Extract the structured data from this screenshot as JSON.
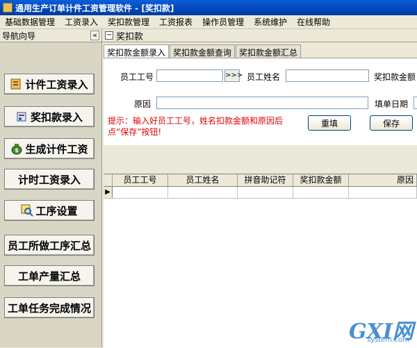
{
  "window": {
    "title": "通用生产订单计件工资管理软件 - [奖扣款]"
  },
  "menu": [
    "基础数据管理",
    "工资录入",
    "奖扣款管理",
    "工资报表",
    "操作员管理",
    "系统维护",
    "在线帮助"
  ],
  "nav": {
    "title": "导航向导",
    "collapse": "«",
    "items": [
      "计件工资录入",
      "奖扣款录入",
      "生成计件工资",
      "计时工资录入",
      "工序设置",
      "员工所做工序汇总",
      "工单产量汇总",
      "工单任务完成情况"
    ]
  },
  "panel": {
    "title": "奖扣款",
    "minus": "−",
    "tabs": [
      "奖扣款金额录入",
      "奖扣款金额查询",
      "奖扣款金额汇总"
    ]
  },
  "form": {
    "emp_id_label": "员工工号",
    "emp_id_value": "",
    "lookup": ">>>",
    "emp_name_label": "员工姓名",
    "emp_name_value": "",
    "amount_label": "奖扣款金额",
    "reason_label": "原因",
    "reason_value": "",
    "date_label": "填单日期",
    "hint": "提示：输入好员工工号，姓名扣款金额和原因后点“保存”按钮!",
    "reset_label": "重填",
    "save_label": "保存"
  },
  "grid": {
    "columns": [
      "员工工号",
      "员工姓名",
      "拼音助记符",
      "奖扣款金额",
      "原因"
    ],
    "row_indicator": "▶"
  },
  "watermark": {
    "brand": "GXI网",
    "site": "system.com"
  }
}
